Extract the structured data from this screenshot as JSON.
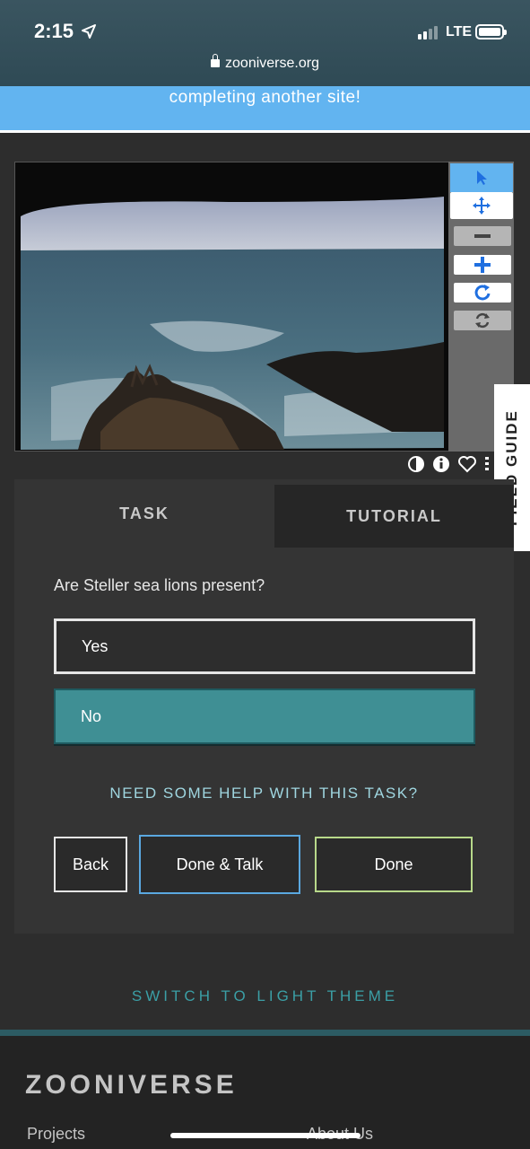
{
  "status_bar": {
    "time": "2:15",
    "carrier": "LTE",
    "url": "zooniverse.org"
  },
  "banner": {
    "text": "completing another site!"
  },
  "viewer": {
    "tools": [
      "pointer-icon",
      "move-icon",
      "zoom-out-icon",
      "zoom-in-icon",
      "rotate-icon",
      "reset-icon"
    ],
    "meta_icons": [
      "invert-icon",
      "info-icon",
      "favorite-icon",
      "more-icon"
    ]
  },
  "field_guide": {
    "label": "FIELD GUIDE"
  },
  "task": {
    "tabs": [
      {
        "label": "TASK",
        "active": true
      },
      {
        "label": "TUTORIAL",
        "active": false
      }
    ],
    "question": "Are Steller sea lions present?",
    "answers": [
      {
        "label": "Yes",
        "selected": false
      },
      {
        "label": "No",
        "selected": true
      }
    ],
    "help_link": "NEED SOME HELP WITH THIS TASK?",
    "buttons": {
      "back": "Back",
      "done_talk": "Done & Talk",
      "done": "Done"
    }
  },
  "theme_switch": "SWITCH TO LIGHT THEME",
  "footer": {
    "logo": "ZOONIVERSE",
    "links": [
      "Projects",
      "About Us"
    ]
  },
  "colors": {
    "accent_blue": "#62b4f0",
    "selected_teal": "#3f8f94",
    "help_text": "#9fd6e0",
    "theme_link": "#3b9fa6"
  }
}
